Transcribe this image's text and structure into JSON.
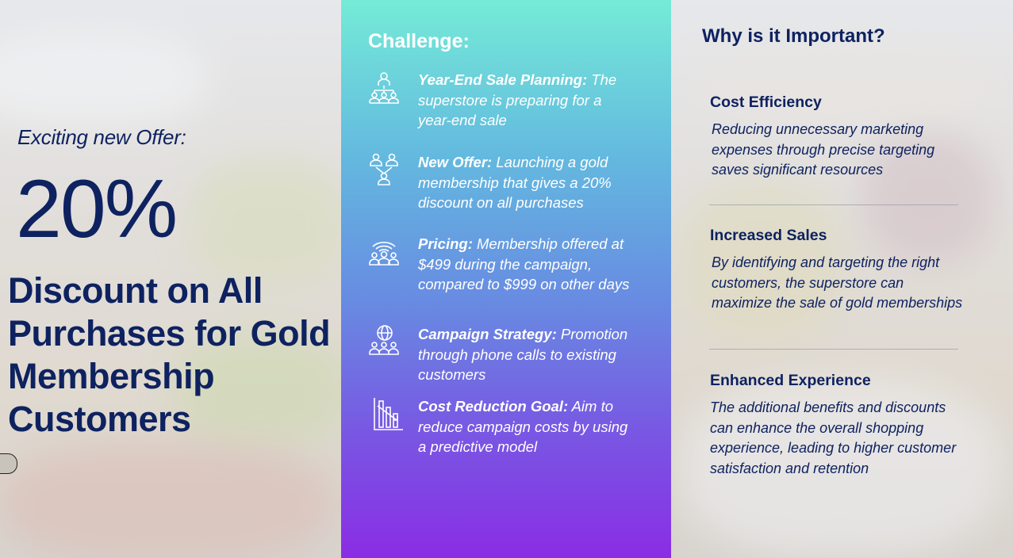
{
  "left": {
    "offer_label": "Exciting new Offer:",
    "percent": "20%",
    "headline": "Discount on All Purchases for Gold Membership Customers"
  },
  "challenge": {
    "title": "Challenge:",
    "items": [
      {
        "icon": "org-chart-people-icon",
        "title": "Year-End Sale Planning:",
        "text": " The superstore is preparing for a year-end sale"
      },
      {
        "icon": "team-connection-icon",
        "title": "New Offer:",
        "text": " Launching a gold membership that gives a 20% discount on all purchases"
      },
      {
        "icon": "broadcast-group-icon",
        "title": "Pricing:",
        "text": " Membership offered at $499 during the campaign, compared to $999 on other days"
      },
      {
        "icon": "globe-group-icon",
        "title": "Campaign Strategy:",
        "text": " Promotion through phone calls to existing customers"
      },
      {
        "icon": "declining-chart-icon",
        "title": "Cost Reduction Goal:",
        "text": " Aim to reduce campaign costs by using a predictive model"
      }
    ]
  },
  "importance": {
    "title": "Why is it Important?",
    "sections": [
      {
        "heading": "Cost Efficiency",
        "text": "Reducing unnecessary marketing expenses through precise targeting saves significant resources"
      },
      {
        "heading": "Increased Sales",
        "text": "By identifying and targeting the right customers, the superstore can maximize the sale of gold memberships"
      },
      {
        "heading": "Enhanced Experience",
        "text": "The additional benefits and discounts can enhance the overall shopping experience, leading to higher customer satisfaction and retention"
      }
    ]
  },
  "colors": {
    "navy": "#0e2260",
    "gradient_top": "#75ebd7",
    "gradient_bottom": "#8a2de4",
    "white": "#ffffff"
  }
}
